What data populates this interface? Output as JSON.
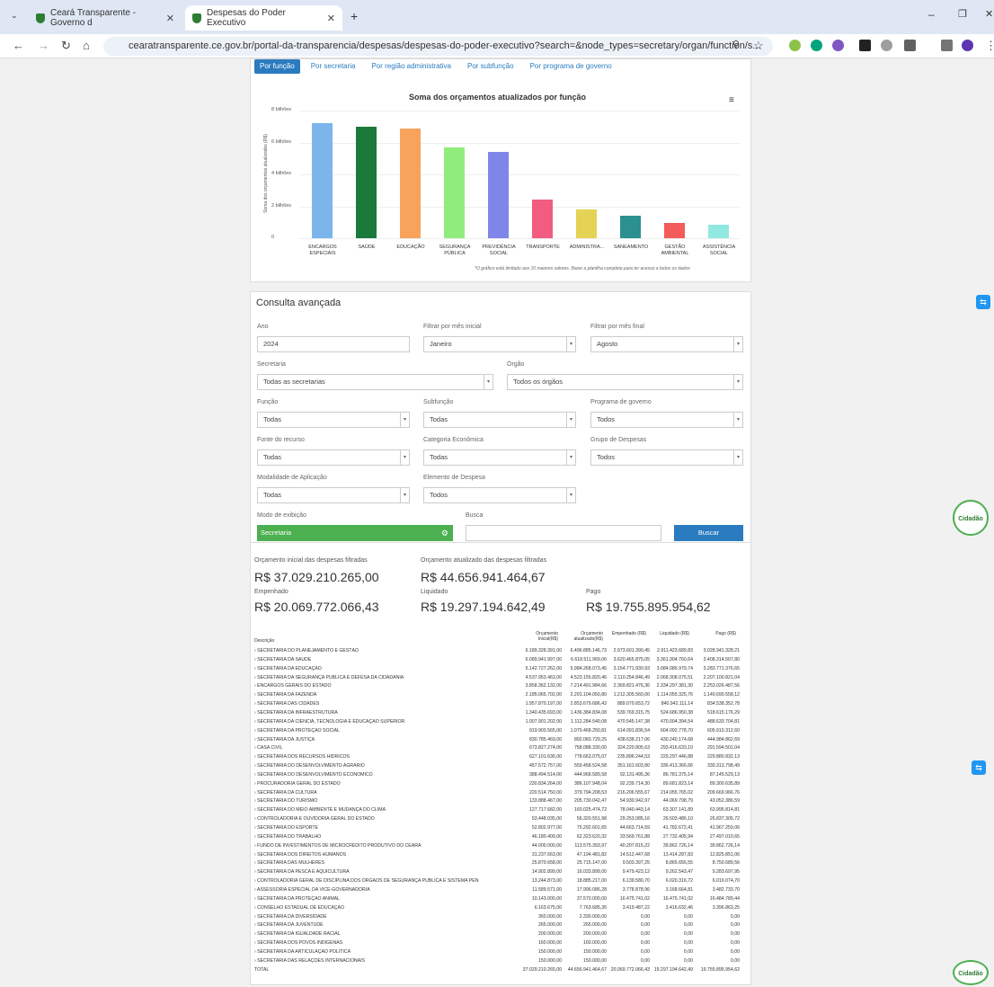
{
  "browser": {
    "tabs": [
      {
        "title": "Ceará Transparente - Governo d"
      },
      {
        "title": "Despesas do Poder Executivo"
      }
    ],
    "url": "cearatransparente.ce.gov.br/portal-da-transparencia/despesas/despesas-do-poder-executivo?search=&node_types=secretary/organ/function/s..."
  },
  "filter_tabs": [
    "Por função",
    "Por secretaria",
    "Por região administrativa",
    "Por subfunção",
    "Por programa de governo"
  ],
  "chart_data": {
    "type": "bar",
    "title": "Soma dos orçamentos atualizados por função",
    "ylabel": "Soma dos orçamentos atualizados (R$)",
    "yticks": [
      "0",
      "2 bilhões",
      "4 bilhões",
      "6 bilhões",
      "8 bilhões"
    ],
    "ylim": [
      0,
      8
    ],
    "categories": [
      "ENCARGOS ESPECIAIS",
      "SAÚDE",
      "EDUCAÇÃO",
      "SEGURANÇA PÚBLICA",
      "PREVIDÊNCIA SOCIAL",
      "TRANSPORTE",
      "ADMINISTRA...",
      "SANEAMENTO",
      "GESTÃO AMBIENTAL",
      "ASSISTÊNCIA SOCIAL"
    ],
    "values": [
      7.2,
      7.0,
      6.9,
      5.7,
      5.4,
      2.4,
      1.8,
      1.4,
      0.95,
      0.85
    ],
    "colors": [
      "#7cb5ec",
      "#1b7a3a",
      "#f7a35c",
      "#90ed7d",
      "#8085e9",
      "#f15c80",
      "#e4d354",
      "#2b908f",
      "#f45b5b",
      "#91e8e1"
    ],
    "footnote": "*O gráfico está limitado aos 10 maiores valores. Baixe a planilha completa para ter acesso a todos os dados"
  },
  "consulta": {
    "title": "Consulta avançada",
    "fields": [
      {
        "label": "Ano",
        "value": "2024"
      },
      {
        "label": "Filtrar por mês inicial",
        "value": "Janeiro"
      },
      {
        "label": "Filtrar por mês final",
        "value": "Agosto"
      },
      {
        "label": "Secretaria",
        "value": "Todas as secretarias"
      },
      {
        "label": "Órgão",
        "value": "Todos os órgãos"
      },
      {
        "label": "Função",
        "value": "Todas"
      },
      {
        "label": "Subfunção",
        "value": "Todas"
      },
      {
        "label": "Programa de governo",
        "value": "Todos"
      },
      {
        "label": "Fonte do recurso",
        "value": "Todas"
      },
      {
        "label": "Categoria Econômica",
        "value": "Todas"
      },
      {
        "label": "Grupo de Despesas",
        "value": "Todos"
      },
      {
        "label": "Modalidade de Aplicação",
        "value": "Todas"
      },
      {
        "label": "Elemento de Despesa",
        "value": "Todos"
      }
    ],
    "modo_label": "Modo de exibição",
    "modo_value": "Secretaria",
    "busca_label": "Busca",
    "buscar_btn": "Buscar"
  },
  "totals": {
    "orc_ini_label": "Orçamento inicial das despesas filtradas",
    "orc_ini": "R$ 37.029.210.265,00",
    "orc_at_label": "Orçamento atualizado das despesas filtradas",
    "orc_at": "R$ 44.656.941.464,67",
    "emp_label": "Empenhado",
    "emp": "R$ 20.069.772.066,43",
    "liq_label": "Liquidado",
    "liq": "R$ 19.297.194.642,49",
    "pago_label": "Pago",
    "pago": "R$ 19.755.895.954,62"
  },
  "table": {
    "headers": [
      "Descrição",
      "Orçamento Inicial(R$)",
      "Orçamento atualizado(R$)",
      "Empenhado (R$)",
      "Liquidado (R$)",
      "Pago (R$)"
    ],
    "rows": [
      [
        "› SECRETARIA DO PLANEJAMENTO E GESTÃO",
        "6.189.328.391,00",
        "6.496.885.146,73",
        "2.973.601.390,45",
        "2.911.423.689,83",
        "3.028.941.328,21"
      ],
      [
        "› SECRETARIA DA SAÚDE",
        "6.089.941.997,00",
        "6.618.511.969,06",
        "3.620.465.875,05",
        "3.361.304.760,64",
        "3.408.314.507,80"
      ],
      [
        "› SECRETARIA DA EDUCAÇÃO",
        "5.142.727.262,00",
        "5.984.268.073,45",
        "3.154.771.930,93",
        "3.084.086.979,74",
        "3.283.771.376,65"
      ],
      [
        "› SECRETARIA DA SEGURANÇA PÚBLICA E DEFESA DA CIDADANIA",
        "4.537.953.463,00",
        "4.523.155.820,46",
        "2.110.254.846,49",
        "2.068.308.075,51",
        "2.207.100.821,04"
      ],
      [
        "› ENCARGOS GERAIS DO ESTADO",
        "3.858.362.132,00",
        "7.214.491.984,66",
        "2.369.821.476,36",
        "2.334.297.381,30",
        "2.253.026.487,56"
      ],
      [
        "› SECRETARIA DA FAZENDA",
        "2.185.065.702,00",
        "2.291.104.050,80",
        "1.212.305.560,00",
        "1.114.055.325,76",
        "1.140.690.558,12"
      ],
      [
        "› SECRETARIA DAS CIDADES",
        "1.957.870.197,00",
        "2.853.679.686,43",
        "889.070.653,72",
        "840.942.111,14",
        "834.538.352,78"
      ],
      [
        "› SECRETARIA DA INFRAESTRUTURA",
        "1.340.435.693,00",
        "1.436.384.834,08",
        "539.769.315,75",
        "524.686.950,38",
        "518.615.176,29"
      ],
      [
        "› SECRETARIA DA CIÊNCIA, TECNOLOGIA E EDUCAÇÃO SUPERIOR",
        "1.007.901.202,00",
        "1.112.284.540,08",
        "470.545.147,38",
        "470.004.394,54",
        "488.633.704,81"
      ],
      [
        "› SECRETARIA DA PROTEÇÃO SOCIAL",
        "919.903.565,00",
        "1.079.468.250,81",
        "614.091.836,54",
        "604.092.778,70",
        "605.910.312,60"
      ],
      [
        "› SECRETARIA DA JUSTIÇA",
        "830.785.469,00",
        "892.083.729,25",
        "438.638.217,06",
        "430.240.174,68",
        "444.984.862,69"
      ],
      [
        "› CASA CIVIL",
        "673.827.274,00",
        "758.088.330,00",
        "324.220.805,63",
        "293.416.633,10",
        "291.594.501,04"
      ],
      [
        "› SECRETARIA DOS RECURSOS HÍDRICOS",
        "627.101.636,00",
        "778.663.075,07",
        "235.896.244,53",
        "229.297.446,88",
        "229.880.832,13"
      ],
      [
        "› SECRETARIA DO DESENVOLVIMENTO AGRÁRIO",
        "457.572.757,00",
        "559.458.524,58",
        "351.161.603,80",
        "336.413.366,66",
        "330.313.798,49"
      ],
      [
        "› SECRETARIA DO DESENVOLVIMENTO ECONÔMICO",
        "388.494.514,00",
        "444.968.589,58",
        "92.131.495,36",
        "86.781.375,14",
        "87.145.529,13"
      ],
      [
        "› PROCURADORIA GERAL DO ESTADO",
        "230.834.264,00",
        "386.107.948,04",
        "92.239.714,30",
        "89.681.823,14",
        "89.300.635,89"
      ],
      [
        "› SECRETARIA DA CULTURA",
        "220.514.750,00",
        "379.794.208,53",
        "216.206.555,67",
        "214.055.765,02",
        "209.669.966,76"
      ],
      [
        "› SECRETARIA DO TURISMO",
        "133.888.467,00",
        "205.730.042,47",
        "54.930.942,97",
        "44.069.798,79",
        "43.052.386,59"
      ],
      [
        "› SECRETARIA DO MEIO AMBIENTE E MUDANÇA DO CLIMA",
        "127.717.682,00",
        "160.025.474,72",
        "78.040.443,14",
        "63.307.141,89",
        "63.995.814,81"
      ],
      [
        "› CONTROLADORIA E OUVIDORIA GERAL DO ESTADO",
        "53.448.035,00",
        "56.320.551,98",
        "29.253.085,16",
        "26.503.486,10",
        "26.837.305,72"
      ],
      [
        "› SECRETARIA DO ESPORTE",
        "52.802.977,00",
        "75.292.601,65",
        "44.663.714,59",
        "41.782.672,41",
        "41.967.259,06"
      ],
      [
        "› SECRETARIA DO TRABALHO",
        "46.180.409,00",
        "62.323.620,32",
        "33.569.761,88",
        "27.732.405,94",
        "27.497.010,65"
      ],
      [
        "› FUNDO DE INVESTIMENTOS DE MICROCRÉDITO PRODUTIVO DO CEARÁ",
        "44.000.000,00",
        "113.575.393,97",
        "40.207.815,22",
        "39.862.726,14",
        "39.862.726,14"
      ],
      [
        "› SECRETARIA DOS DIREITOS HUMANOS",
        "31.237.663,00",
        "47.194.481,82",
        "14.512.447,68",
        "13.414.287,83",
        "12.825.851,06"
      ],
      [
        "› SECRETARIA DAS MULHERES",
        "25.870.658,00",
        "25.715.147,00",
        "9.503.397,25",
        "8.865.656,55",
        "8.750.689,56"
      ],
      [
        "› SECRETARIA DA PESCA E AQUICULTURA",
        "14.902.899,00",
        "16.033.899,00",
        "9.479.423,12",
        "9.262.543,47",
        "9.283.697,95"
      ],
      [
        "› CONTROLADORIA GERAL DE DISCIPLINA DOS ÓRGÃOS DE SEGURANÇA PÚBLICA E SISTEMA PENITENCIÁRIO",
        "13.244.873,00",
        "18.885.217,00",
        "6.139.580,70",
        "6.020.316,72",
        "6.019.074,70"
      ],
      [
        "› ASSESSORIA ESPECIAL DA VICE-GOVERNADORIA",
        "11.589.571,00",
        "17.996.086,28",
        "3.778.878,96",
        "3.168.664,81",
        "3.482.733,70"
      ],
      [
        "› SECRETARIA DA PROTEÇÃO ANIMAL",
        "10.143.000,00",
        "37.570.000,00",
        "16.475.741,02",
        "16.475.741,02",
        "16.484.789,44"
      ],
      [
        "› CONSELHO ESTADUAL DE EDUCAÇÃO",
        "6.163.675,00",
        "7.763.685,30",
        "3.419.487,22",
        "3.416.632,46",
        "3.396.863,25"
      ],
      [
        "› SECRETARIA DA DIVERSIDADE",
        "360.000,00",
        "2.330.000,00",
        "0,00",
        "0,00",
        "0,00"
      ],
      [
        "› SECRETARIA DA JUVENTUDE",
        "265.000,00",
        "265.000,00",
        "0,00",
        "0,00",
        "0,00"
      ],
      [
        "› SECRETARIA DA IGUALDADE RACIAL",
        "200.000,00",
        "200.000,00",
        "0,00",
        "0,00",
        "0,00"
      ],
      [
        "› SECRETARIA DOS POVOS INDÍGENAS",
        "160.000,00",
        "160.000,00",
        "0,00",
        "0,00",
        "0,00"
      ],
      [
        "› SECRETARIA DA ARTICULAÇÃO POLÍTICA",
        "150.000,00",
        "150.000,00",
        "0,00",
        "0,00",
        "0,00"
      ],
      [
        "› SECRETARIA DAS RELAÇÕES INTERNACIONAIS",
        "150.000,00",
        "150.000,00",
        "0,00",
        "0,00",
        "0,00"
      ]
    ],
    "total": [
      "TOTAL",
      "37.029.210.265,00",
      "44.656.941.464,67",
      "20.069.772.066,43",
      "19.297.194.642,49",
      "19.755.895.954,62"
    ]
  },
  "float": {
    "cidadao": "Cidadão"
  }
}
